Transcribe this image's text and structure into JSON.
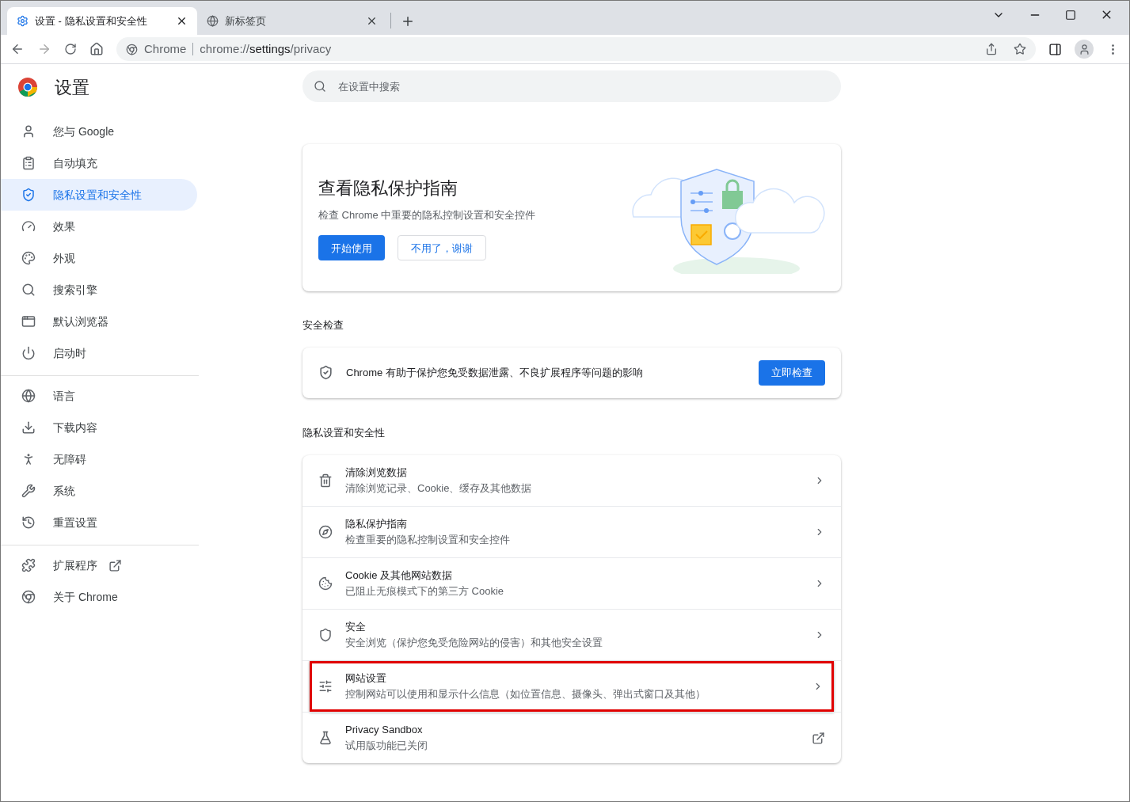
{
  "tabs": [
    {
      "title": "设置 - 隐私设置和安全性",
      "selected": true
    },
    {
      "title": "新标签页",
      "selected": false
    }
  ],
  "address": {
    "origin": "Chrome",
    "url_host": "chrome://",
    "url_path": "settings",
    "url_rest": "/privacy"
  },
  "header": {
    "title": "设置",
    "search_placeholder": "在设置中搜索"
  },
  "sidebar": {
    "groups": [
      [
        {
          "label": "您与 Google",
          "selected": false,
          "external": false
        },
        {
          "label": "自动填充",
          "selected": false,
          "external": false
        },
        {
          "label": "隐私设置和安全性",
          "selected": true,
          "external": false
        },
        {
          "label": "效果",
          "selected": false,
          "external": false
        },
        {
          "label": "外观",
          "selected": false,
          "external": false
        },
        {
          "label": "搜索引擎",
          "selected": false,
          "external": false
        },
        {
          "label": "默认浏览器",
          "selected": false,
          "external": false
        },
        {
          "label": "启动时",
          "selected": false,
          "external": false
        }
      ],
      [
        {
          "label": "语言",
          "selected": false,
          "external": false
        },
        {
          "label": "下载内容",
          "selected": false,
          "external": false
        },
        {
          "label": "无障碍",
          "selected": false,
          "external": false
        },
        {
          "label": "系统",
          "selected": false,
          "external": false
        },
        {
          "label": "重置设置",
          "selected": false,
          "external": false
        }
      ],
      [
        {
          "label": "扩展程序",
          "selected": false,
          "external": true
        },
        {
          "label": "关于 Chrome",
          "selected": false,
          "external": false
        }
      ]
    ]
  },
  "guide_card": {
    "title": "查看隐私保护指南",
    "description": "检查 Chrome 中重要的隐私控制设置和安全控件",
    "primary_button": "开始使用",
    "secondary_button": "不用了，谢谢"
  },
  "safety_check": {
    "heading": "安全检查",
    "text": "Chrome 有助于保护您免受数据泄露、不良扩展程序等问题的影响",
    "button": "立即检查"
  },
  "privacy": {
    "heading": "隐私设置和安全性",
    "rows": [
      {
        "title": "清除浏览数据",
        "subtitle": "清除浏览记录、Cookie、缓存及其他数据",
        "external": false,
        "highlighted": false
      },
      {
        "title": "隐私保护指南",
        "subtitle": "检查重要的隐私控制设置和安全控件",
        "external": false,
        "highlighted": false
      },
      {
        "title": "Cookie 及其他网站数据",
        "subtitle": "已阻止无痕模式下的第三方 Cookie",
        "external": false,
        "highlighted": false
      },
      {
        "title": "安全",
        "subtitle": "安全浏览（保护您免受危险网站的侵害）和其他安全设置",
        "external": false,
        "highlighted": false
      },
      {
        "title": "网站设置",
        "subtitle": "控制网站可以使用和显示什么信息（如位置信息、摄像头、弹出式窗口及其他）",
        "external": false,
        "highlighted": true
      },
      {
        "title": "Privacy Sandbox",
        "subtitle": "试用版功能已关闭",
        "external": true,
        "highlighted": false
      }
    ]
  }
}
